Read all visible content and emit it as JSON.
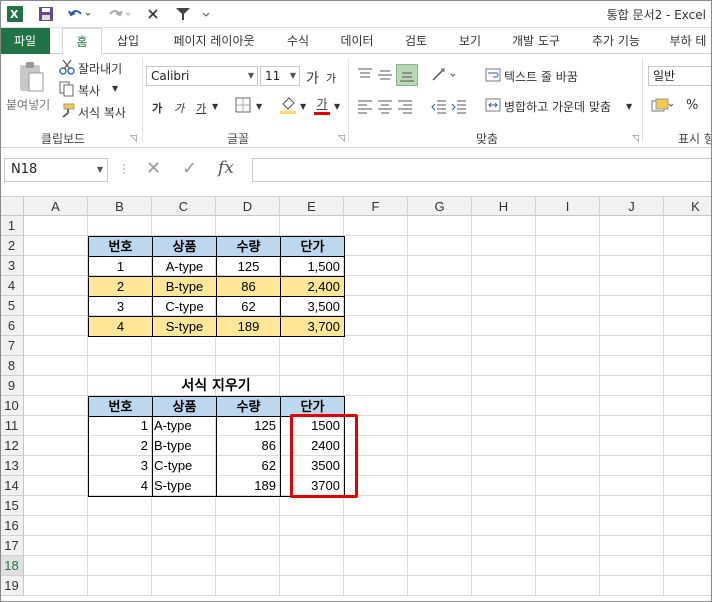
{
  "window": {
    "title": "통합 문서2 - Excel",
    "qat": [
      "excel-logo-icon",
      "save-icon",
      "undo-icon",
      "redo-icon",
      "close-x-icon",
      "filter-icon"
    ]
  },
  "tabs": [
    "파일",
    "홈",
    "삽입",
    "페이지 레이아웃",
    "수식",
    "데이터",
    "검토",
    "보기",
    "개발 도구",
    "추가 기능",
    "부하 테"
  ],
  "ribbon": {
    "clipboard": {
      "paste": "붙여넣기",
      "cut": "잘라내기",
      "copy": "복사",
      "format_painter": "서식 복사",
      "label": "클립보드"
    },
    "font": {
      "name": "Calibri",
      "size": "11",
      "grow": "가",
      "shrink": "가",
      "bold": "가",
      "italic": "가",
      "underline": "가",
      "font_color": "가",
      "label": "글꼴"
    },
    "alignment": {
      "wrap": "텍스트 줄 바꿈",
      "merge": "병합하고 가운데 맞춤",
      "label": "맞춤"
    },
    "number": {
      "format": "일반",
      "percent": "%",
      "label": "표시 형"
    }
  },
  "formula_bar": {
    "name_box": "N18",
    "cancel": "✕",
    "enter": "✓",
    "fx": "fx",
    "value": ""
  },
  "sheet": {
    "columns": [
      "A",
      "B",
      "C",
      "D",
      "E",
      "F",
      "G",
      "H",
      "I",
      "J",
      "K"
    ],
    "rows": [
      "1",
      "2",
      "3",
      "4",
      "5",
      "6",
      "7",
      "8",
      "9",
      "10",
      "11",
      "12",
      "13",
      "14",
      "15",
      "16",
      "17",
      "18",
      "19"
    ],
    "selected_row": "18",
    "table1": {
      "headers": [
        "번호",
        "상품",
        "수량",
        "단가"
      ],
      "rows": [
        [
          "1",
          "A-type",
          "125",
          "1,500"
        ],
        [
          "2",
          "B-type",
          "86",
          "2,400"
        ],
        [
          "3",
          "C-type",
          "62",
          "3,500"
        ],
        [
          "4",
          "S-type",
          "189",
          "3,700"
        ]
      ]
    },
    "section_title": "서식 지우기",
    "table2": {
      "headers": [
        "번호",
        "상품",
        "수량",
        "단가"
      ],
      "rows": [
        [
          "1",
          "A-type",
          "125",
          "1500"
        ],
        [
          "2",
          "B-type",
          "86",
          "2400"
        ],
        [
          "3",
          "C-type",
          "62",
          "3500"
        ],
        [
          "4",
          "S-type",
          "189",
          "3700"
        ]
      ]
    }
  },
  "colors": {
    "excel_green": "#217346",
    "header_blue": "#bdd7ee",
    "highlight_yellow": "#ffe699",
    "annotation_red": "#e00000"
  }
}
